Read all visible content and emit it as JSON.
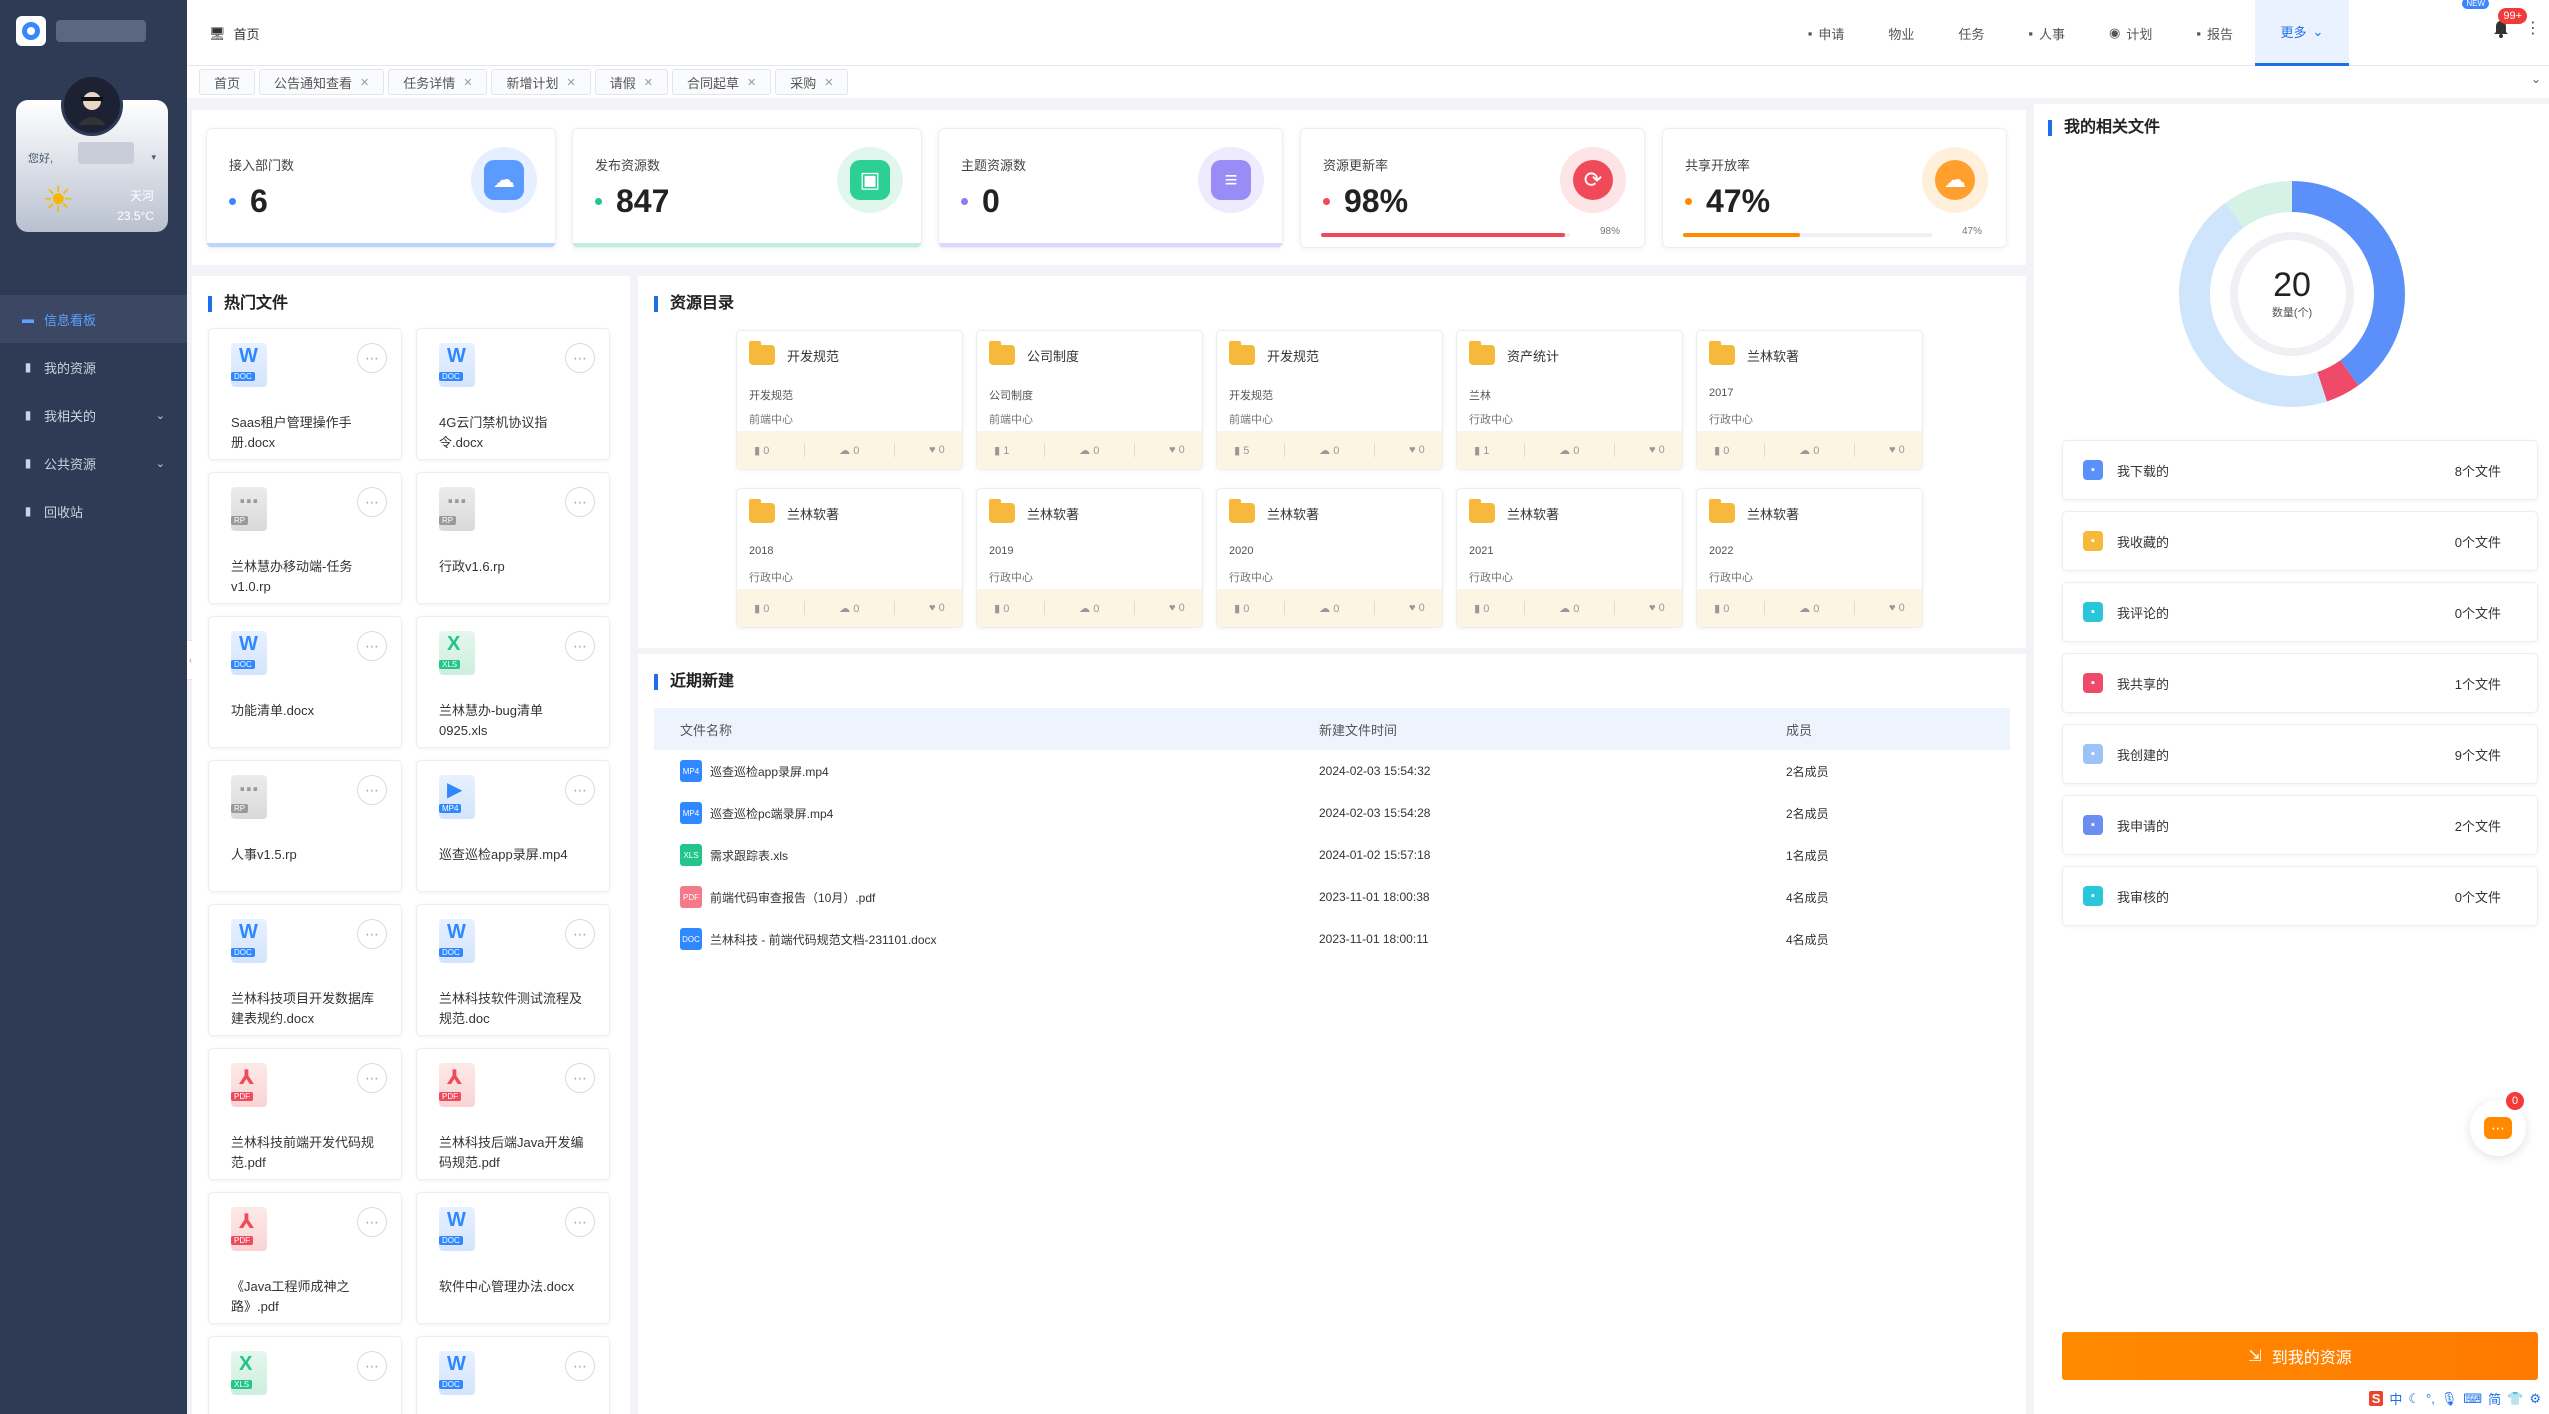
{
  "sidebar": {
    "greeting": "您好,",
    "weather_text": "天河",
    "temperature": "23.5°C",
    "nav": [
      {
        "label": "信息看板",
        "icon": "dashboard-icon",
        "active": true
      },
      {
        "label": "我的资源",
        "icon": "file-icon",
        "active": false
      },
      {
        "label": "我相关的",
        "icon": "folder-icon",
        "active": false,
        "expandable": true
      },
      {
        "label": "公共资源",
        "icon": "lock-icon",
        "active": false,
        "expandable": true
      },
      {
        "label": "回收站",
        "icon": "trash-icon",
        "active": false
      }
    ]
  },
  "topbar": {
    "home_label": "首页",
    "menu": [
      {
        "label": "申请",
        "icon": "briefcase-icon"
      },
      {
        "label": "物业",
        "icon": ""
      },
      {
        "label": "任务",
        "icon": ""
      },
      {
        "label": "人事",
        "icon": "briefcase-icon"
      },
      {
        "label": "计划",
        "icon": "eye-icon"
      },
      {
        "label": "报告",
        "icon": "document-icon"
      },
      {
        "label": "更多",
        "icon": "chevron-down-icon"
      }
    ],
    "new_badge": "NEW",
    "notify_count": "99+"
  },
  "tabs": [
    "首页",
    "公告通知查看",
    "任务详情",
    "新增计划",
    "请假",
    "合同起草",
    "采购"
  ],
  "stats": [
    {
      "label": "接入部门数",
      "value": "6",
      "dot_color": "#3a86ff",
      "accent": "#bcd5ff"
    },
    {
      "label": "发布资源数",
      "value": "847",
      "dot_color": "#22c58b",
      "accent": "#bff0dc"
    },
    {
      "label": "主题资源数",
      "value": "0",
      "dot_color": "#8a7cf5",
      "accent": "#ddd7ff"
    },
    {
      "label": "资源更新率",
      "value": "98%",
      "dot_color": "#f04a5a",
      "bar_pct": 98,
      "bar_label": "98%",
      "bar_color": "#f04a5a"
    },
    {
      "label": "共享开放率",
      "value": "47%",
      "dot_color": "#ff8a00",
      "bar_pct": 47,
      "bar_label": "47%",
      "bar_color": "#ff8a00"
    }
  ],
  "hot_files": {
    "title": "热门文件",
    "files": [
      {
        "name": "Saas租户管理操作手册.docx",
        "type": "doc"
      },
      {
        "name": "4G云门禁机协议指令.docx",
        "type": "doc"
      },
      {
        "name": "兰林慧办移动端-任务v1.0.rp",
        "type": "rp"
      },
      {
        "name": "行政v1.6.rp",
        "type": "rp"
      },
      {
        "name": "功能清单.docx",
        "type": "doc"
      },
      {
        "name": "兰林慧办-bug清单0925.xls",
        "type": "xls"
      },
      {
        "name": "人事v1.5.rp",
        "type": "rp"
      },
      {
        "name": "巡查巡检app录屏.mp4",
        "type": "mp4"
      },
      {
        "name": "兰林科技项目开发数据库建表规约.docx",
        "type": "doc"
      },
      {
        "name": "兰林科技软件测试流程及规范.doc",
        "type": "doc"
      },
      {
        "name": "兰林科技前端开发代码规范.pdf",
        "type": "pdf"
      },
      {
        "name": "兰林科技后端Java开发编码规范.pdf",
        "type": "pdf"
      },
      {
        "name": "《Java工程师成神之路》.pdf",
        "type": "pdf"
      },
      {
        "name": "软件中心管理办法.docx",
        "type": "doc"
      },
      {
        "name": "",
        "type": "xls"
      },
      {
        "name": "",
        "type": "doc"
      }
    ]
  },
  "resource_dir": {
    "title": "资源目录",
    "folders": [
      {
        "title": "开发规范",
        "sub1": "开发规范",
        "sub2": "前端中心",
        "c1": "0",
        "c2": "0",
        "c3": "0"
      },
      {
        "title": "公司制度",
        "sub1": "公司制度",
        "sub2": "前端中心",
        "c1": "1",
        "c2": "0",
        "c3": "0"
      },
      {
        "title": "开发规范",
        "sub1": "开发规范",
        "sub2": "前端中心",
        "c1": "5",
        "c2": "0",
        "c3": "0"
      },
      {
        "title": "资产统计",
        "sub1": "兰林",
        "sub2": "行政中心",
        "c1": "1",
        "c2": "0",
        "c3": "0"
      },
      {
        "title": "兰林软著",
        "sub1": "2017",
        "sub2": "行政中心",
        "c1": "0",
        "c2": "0",
        "c3": "0"
      },
      {
        "title": "兰林软著",
        "sub1": "2018",
        "sub2": "行政中心",
        "c1": "0",
        "c2": "0",
        "c3": "0"
      },
      {
        "title": "兰林软著",
        "sub1": "2019",
        "sub2": "行政中心",
        "c1": "0",
        "c2": "0",
        "c3": "0"
      },
      {
        "title": "兰林软著",
        "sub1": "2020",
        "sub2": "行政中心",
        "c1": "0",
        "c2": "0",
        "c3": "0"
      },
      {
        "title": "兰林软著",
        "sub1": "2021",
        "sub2": "行政中心",
        "c1": "0",
        "c2": "0",
        "c3": "0"
      },
      {
        "title": "兰林软著",
        "sub1": "2022",
        "sub2": "行政中心",
        "c1": "0",
        "c2": "0",
        "c3": "0"
      }
    ]
  },
  "recent": {
    "title": "近期新建",
    "columns": [
      "文件名称",
      "新建文件时间",
      "成员"
    ],
    "rows": [
      {
        "type": "MP4",
        "color": "#2f88ff",
        "name": "巡查巡检app录屏.mp4",
        "time": "2024-02-03 15:54:32",
        "members": "2名成员"
      },
      {
        "type": "MP4",
        "color": "#2f88ff",
        "name": "巡查巡检pc端录屏.mp4",
        "time": "2024-02-03 15:54:28",
        "members": "2名成员"
      },
      {
        "type": "XLS",
        "color": "#22c58b",
        "name": "需求跟踪表.xls",
        "time": "2024-01-02 15:57:18",
        "members": "1名成员"
      },
      {
        "type": "PDF",
        "color": "#f47a8a",
        "name": "前端代码审查报告（10月）.pdf",
        "time": "2023-11-01 18:00:38",
        "members": "4名成员"
      },
      {
        "type": "DOC",
        "color": "#2f88ff",
        "name": "兰林科技 - 前端代码规范文档-231101.docx",
        "time": "2023-11-01 18:00:11",
        "members": "4名成员"
      }
    ]
  },
  "my_files": {
    "title": "我的相关文件",
    "donut_total": "20",
    "donut_unit": "数量(个)",
    "segments": [
      {
        "label": "我下载的",
        "value": 8,
        "color": "#5b8ff9"
      },
      {
        "label": "我共享的",
        "value": 1,
        "color": "#f04a6a"
      },
      {
        "label": "我创建的",
        "value": 9,
        "color": "#cfe5fb"
      },
      {
        "label": "我申请的",
        "value": 2,
        "color": "#d6f2e6"
      }
    ],
    "items": [
      {
        "label": "我下载的",
        "count": "8个文件",
        "color": "#5b8ff9",
        "icon": "download-icon"
      },
      {
        "label": "我收藏的",
        "count": "0个文件",
        "color": "#f6b93b",
        "icon": "star-icon"
      },
      {
        "label": "我评论的",
        "count": "0个文件",
        "color": "#27c6d9",
        "icon": "comment-icon"
      },
      {
        "label": "我共享的",
        "count": "1个文件",
        "color": "#f04a6a",
        "icon": "share-icon"
      },
      {
        "label": "我创建的",
        "count": "9个文件",
        "color": "#9cc3f7",
        "icon": "create-icon"
      },
      {
        "label": "我申请的",
        "count": "2个文件",
        "color": "#6a8ff0",
        "icon": "apply-icon"
      },
      {
        "label": "我审核的",
        "count": "0个文件",
        "color": "#27c6d9",
        "icon": "review-icon"
      }
    ],
    "go_button": "到我的资源"
  },
  "chat": {
    "badge": "0"
  },
  "ime": [
    "中",
    "简"
  ]
}
